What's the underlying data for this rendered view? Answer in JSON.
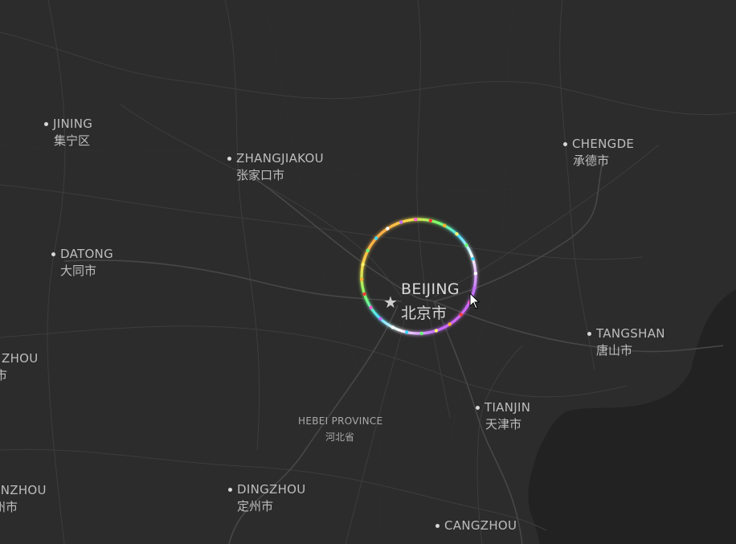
{
  "map": {
    "capital": {
      "name_en": "BEIJING",
      "name_cn": "北京市",
      "marker_icon": "star-icon"
    },
    "cities": [
      {
        "key": "jining",
        "name_en": "JINING",
        "name_cn": "集宁区"
      },
      {
        "key": "zhangjiakou",
        "name_en": "ZHANGJIAKOU",
        "name_cn": "张家口市"
      },
      {
        "key": "chengde",
        "name_en": "CHENGDE",
        "name_cn": "承德市"
      },
      {
        "key": "datong",
        "name_en": "DATONG",
        "name_cn": "大同市"
      },
      {
        "key": "tangshan",
        "name_en": "TANGSHAN",
        "name_cn": "唐山市"
      },
      {
        "key": "tianjin",
        "name_en": "TIANJIN",
        "name_cn": "天津市"
      },
      {
        "key": "dingzhou",
        "name_en": "DINGZHOU",
        "name_cn": "定州市"
      },
      {
        "key": "cangzhou",
        "name_en": "CANGZHOU",
        "name_cn": ""
      }
    ],
    "partial_labels": [
      {
        "key": "left-mid",
        "name_en": "ZHOU",
        "name_cn": "市"
      },
      {
        "key": "left-bottom",
        "name_en": "INZHOU",
        "name_cn": "州市"
      }
    ],
    "province": {
      "name_en": "HEBEI PROVINCE",
      "name_cn": "河北省"
    },
    "colors": {
      "land": "#2c2c2c",
      "sea": "#222222",
      "road": "#3f3f3f",
      "major_road": "#4a4a4a",
      "label": "#bdbdbd"
    },
    "ring_colors": [
      "#ff3b3b",
      "#ffb02e",
      "#fff56b",
      "#6bff7a",
      "#39d9ff",
      "#ffffff",
      "#c46bff",
      "#ff5ad1"
    ]
  }
}
